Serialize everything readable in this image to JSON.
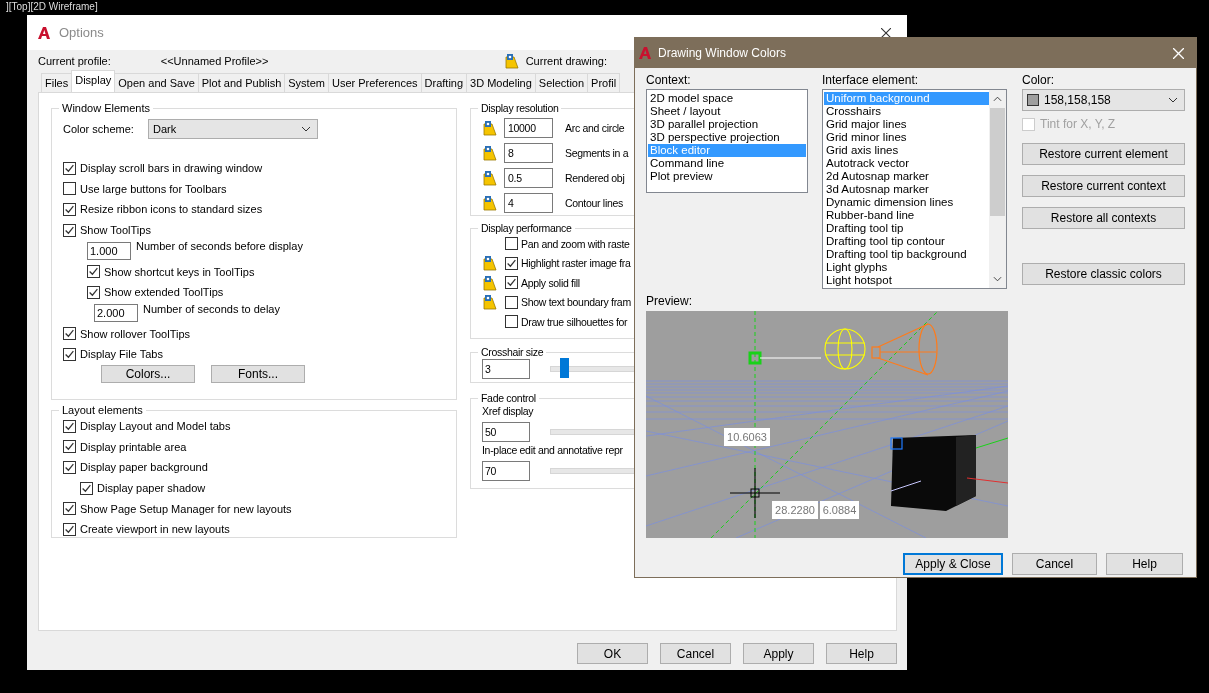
{
  "viewport_label": "][Top][2D Wireframe]",
  "options": {
    "title": "Options",
    "profile_label": "Current profile:",
    "profile_value": "<<Unnamed Profile>>",
    "drawing_label": "Current drawing:",
    "tabs": [
      {
        "label": "Files",
        "selected": false
      },
      {
        "label": "Display",
        "selected": true
      },
      {
        "label": "Open and Save",
        "selected": false
      },
      {
        "label": "Plot and Publish",
        "selected": false
      },
      {
        "label": "System",
        "selected": false
      },
      {
        "label": "User Preferences",
        "selected": false
      },
      {
        "label": "Drafting",
        "selected": false
      },
      {
        "label": "3D Modeling",
        "selected": false
      },
      {
        "label": "Selection",
        "selected": false
      },
      {
        "label": "Profil",
        "selected": false
      }
    ],
    "window_elements": {
      "title": "Window Elements",
      "color_scheme_label": "Color scheme:",
      "color_scheme": "Dark",
      "items": [
        {
          "kind": "check",
          "label": "Display scroll bars in drawing window",
          "checked": true
        },
        {
          "kind": "check",
          "label": "Use large buttons for Toolbars",
          "checked": false
        },
        {
          "kind": "check",
          "label": "Resize ribbon icons to standard sizes",
          "checked": true
        },
        {
          "kind": "check",
          "label": "Show ToolTips",
          "checked": true,
          "children": [
            {
              "kind": "field",
              "value": "1.000",
              "label": "Number of seconds before display"
            },
            {
              "kind": "check",
              "label": "Show shortcut keys in ToolTips",
              "checked": true
            },
            {
              "kind": "check",
              "label": "Show extended ToolTips",
              "checked": true,
              "children": [
                {
                  "kind": "field",
                  "value": "2.000",
                  "label": "Number of seconds to delay"
                }
              ]
            }
          ]
        },
        {
          "kind": "check",
          "label": "Show rollover ToolTips",
          "checked": true
        },
        {
          "kind": "check",
          "label": "Display File Tabs",
          "checked": true
        }
      ],
      "buttons": [
        "Colors...",
        "Fonts..."
      ]
    },
    "layout_elements": {
      "title": "Layout elements",
      "items": [
        {
          "kind": "check",
          "label": "Display Layout and Model tabs",
          "checked": true
        },
        {
          "kind": "check",
          "label": "Display printable area",
          "checked": true
        },
        {
          "kind": "check",
          "label": "Display paper background",
          "checked": true,
          "children": [
            {
              "kind": "check",
              "label": "Display paper shadow",
              "checked": true
            }
          ]
        },
        {
          "kind": "check",
          "label": "Show Page Setup Manager for new layouts",
          "checked": true
        },
        {
          "kind": "check",
          "label": "Create viewport in new layouts",
          "checked": true
        }
      ]
    },
    "display_resolution": {
      "title": "Display resolution",
      "rows": [
        {
          "value": "10000",
          "label": "Arc and circle"
        },
        {
          "value": "8",
          "label": "Segments in a"
        },
        {
          "value": "0.5",
          "label": "Rendered obj"
        },
        {
          "value": "4",
          "label": "Contour lines"
        }
      ]
    },
    "display_performance": {
      "title": "Display performance",
      "items": [
        {
          "label": "Pan and zoom with raste",
          "checked": false,
          "saved_in_drawing": false
        },
        {
          "label": "Highlight raster image fra",
          "checked": true,
          "saved_in_drawing": true
        },
        {
          "label": "Apply solid fill",
          "checked": true,
          "saved_in_drawing": true
        },
        {
          "label": "Show text boundary fram",
          "checked": false,
          "saved_in_drawing": true
        },
        {
          "label": "Draw true silhouettes for",
          "checked": false,
          "saved_in_drawing": false
        }
      ]
    },
    "crosshair": {
      "title": "Crosshair size",
      "value": "3",
      "level": 0.03
    },
    "fade": {
      "title": "Fade control",
      "rows": [
        {
          "label": "Xref display",
          "value": "50"
        },
        {
          "label": "In-place edit and annotative repr",
          "value": "70"
        }
      ]
    },
    "buttons": [
      "OK",
      "Cancel",
      "Apply",
      "Help"
    ]
  },
  "dialog": {
    "title": "Drawing Window Colors",
    "context_label": "Context:",
    "contexts": [
      {
        "label": "2D model space",
        "selected": false
      },
      {
        "label": "Sheet / layout",
        "selected": false
      },
      {
        "label": "3D parallel projection",
        "selected": false
      },
      {
        "label": "3D perspective projection",
        "selected": false
      },
      {
        "label": "Block editor",
        "selected": true
      },
      {
        "label": "Command line",
        "selected": false
      },
      {
        "label": "Plot preview",
        "selected": false
      }
    ],
    "element_label": "Interface element:",
    "elements": [
      {
        "label": "Uniform background",
        "selected": true
      },
      {
        "label": "Crosshairs",
        "selected": false
      },
      {
        "label": "Grid major lines",
        "selected": false
      },
      {
        "label": "Grid minor lines",
        "selected": false
      },
      {
        "label": "Grid axis lines",
        "selected": false
      },
      {
        "label": "Autotrack vector",
        "selected": false
      },
      {
        "label": "2d Autosnap marker",
        "selected": false
      },
      {
        "label": "3d Autosnap marker",
        "selected": false
      },
      {
        "label": "Dynamic dimension lines",
        "selected": false
      },
      {
        "label": "Rubber-band line",
        "selected": false
      },
      {
        "label": "Drafting tool tip",
        "selected": false
      },
      {
        "label": "Drafting tool tip contour",
        "selected": false
      },
      {
        "label": "Drafting tool tip background",
        "selected": false
      },
      {
        "label": "Light glyphs",
        "selected": false
      },
      {
        "label": "Light hotspot",
        "selected": false
      }
    ],
    "color_label": "Color:",
    "color_value": "158,158,158",
    "tint": {
      "label": "Tint for X, Y, Z",
      "checked": false,
      "disabled": true
    },
    "restore_buttons": [
      "Restore current element",
      "Restore current context",
      "Restore all contexts",
      "Restore classic colors"
    ],
    "preview_label": "Preview:",
    "preview_dimensions": [
      "10.6063",
      "28.2280",
      "6.0884"
    ],
    "buttons": [
      {
        "label": "Apply & Close",
        "default": true
      },
      {
        "label": "Cancel",
        "default": false
      },
      {
        "label": "Help",
        "default": false
      }
    ]
  }
}
